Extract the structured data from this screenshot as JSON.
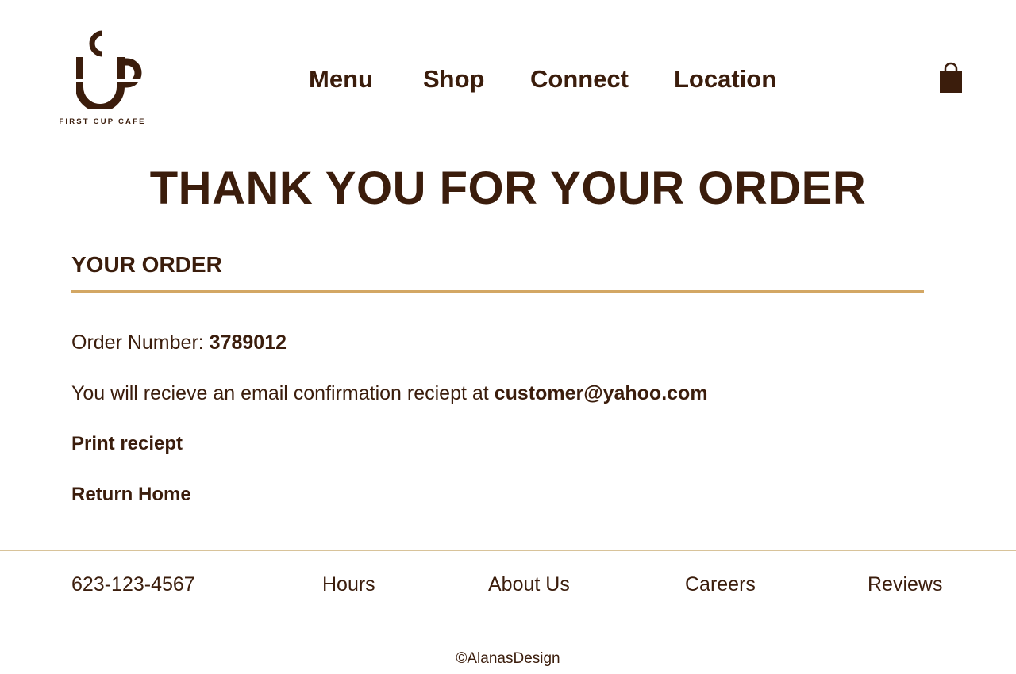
{
  "colors": {
    "text": "#3b1d0c",
    "accent_line": "#d3a764",
    "background": "#ffffff"
  },
  "header": {
    "logo_text": "FIRST CUP CAFE",
    "nav": [
      {
        "label": "Menu"
      },
      {
        "label": "Shop"
      },
      {
        "label": "Connect"
      },
      {
        "label": "Location"
      }
    ],
    "cart_icon": "shopping-bag-icon"
  },
  "main": {
    "title": "THANK YOU FOR YOUR ORDER",
    "section_heading": "YOUR ORDER",
    "order_number_label": "Order Number: ",
    "order_number": "3789012",
    "email_text": "You will recieve an email confirmation reciept at ",
    "email": "customer@yahoo.com",
    "print_link": "Print reciept",
    "home_link": "Return Home"
  },
  "footer": {
    "phone": "623-123-4567",
    "hours": "Hours",
    "about": "About Us",
    "careers": "Careers",
    "reviews": "Reviews",
    "copyright": "©AlanasDesign"
  }
}
